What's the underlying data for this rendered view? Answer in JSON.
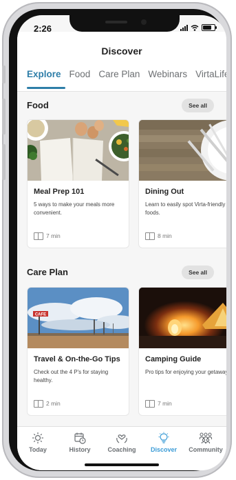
{
  "status": {
    "time": "2:26"
  },
  "header": {
    "title": "Discover",
    "tabs": [
      {
        "label": "Explore",
        "active": true
      },
      {
        "label": "Food"
      },
      {
        "label": "Care Plan"
      },
      {
        "label": "Webinars"
      },
      {
        "label": "VirtaLife"
      }
    ]
  },
  "sections": [
    {
      "title": "Food",
      "see_all": "See all",
      "cards": [
        {
          "title": "Meal Prep 101",
          "description": "5 ways to make your meals more convenient.",
          "duration": "7 min"
        },
        {
          "title": "Dining Out",
          "description": "Learn to easily spot Virta-friendly foods.",
          "duration": "8 min"
        }
      ]
    },
    {
      "title": "Care Plan",
      "see_all": "See all",
      "cards": [
        {
          "title": "Travel & On-the-Go Tips",
          "description": "Check out the 4 P's for staying healthy.",
          "duration": "2 min",
          "sign_text": "CAFE"
        },
        {
          "title": "Camping Guide",
          "description": "Pro tips for enjoying your getaway",
          "duration": "7 min"
        }
      ]
    }
  ],
  "tabbar": {
    "items": [
      {
        "label": "Today",
        "icon": "sun-icon"
      },
      {
        "label": "History",
        "icon": "calendar-history-icon"
      },
      {
        "label": "Coaching",
        "icon": "heart-hands-icon"
      },
      {
        "label": "Discover",
        "icon": "lightbulb-icon",
        "active": true
      },
      {
        "label": "Community",
        "icon": "people-icon"
      }
    ]
  },
  "colors": {
    "accent": "#2e7ea8",
    "active_tab": "#3a9bd6"
  }
}
